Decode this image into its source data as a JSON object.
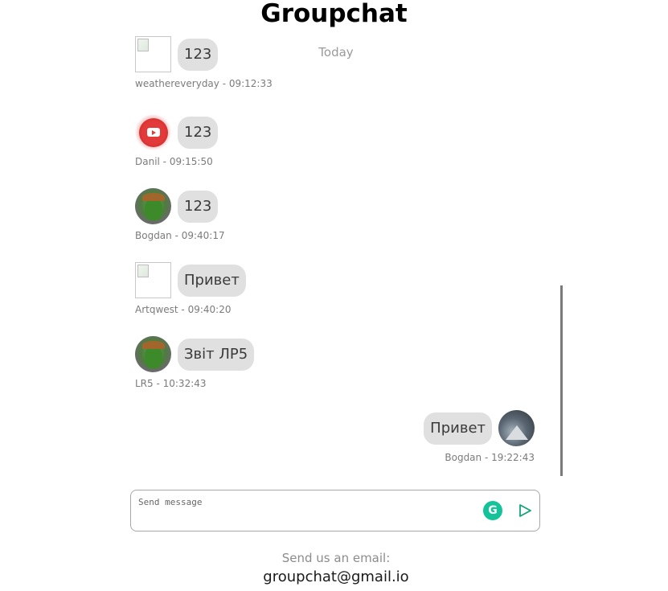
{
  "app": {
    "title": "Groupchat"
  },
  "chat": {
    "day_separator": "Today",
    "messages": [
      {
        "text": "123",
        "author": "weathereveryday",
        "time": "09:12:33",
        "meta": "weathereveryday - 09:12:33",
        "avatar": "broken-image-icon"
      },
      {
        "text": "123",
        "author": "Danil",
        "time": "09:15:50",
        "meta": "Danil - 09:15:50",
        "avatar": "youtube-icon"
      },
      {
        "text": "123",
        "author": "Bogdan",
        "time": "09:40:17",
        "meta": "Bogdan - 09:40:17",
        "avatar": "goblin-avatar"
      },
      {
        "text": "Привет",
        "author": "Artqwest",
        "time": "09:40:20",
        "meta": "Artqwest - 09:40:20",
        "avatar": "broken-image-icon"
      },
      {
        "text": "Звіт ЛР5",
        "author": "LR5",
        "time": "10:32:43",
        "meta": "LR5 - 10:32:43",
        "avatar": "goblin-avatar"
      },
      {
        "text": "Привет",
        "author": "Bogdan",
        "time": "19:22:43",
        "meta": "Bogdan - 19:22:43",
        "avatar": "mountain-avatar",
        "own": true
      }
    ]
  },
  "composer": {
    "placeholder": "Send message",
    "value": "",
    "grammarly_icon": "grammarly-icon",
    "send_icon": "send-icon"
  },
  "footer": {
    "label": "Send us an email:",
    "email": "groupchat@gmail.io"
  },
  "colors": {
    "bubble": "#e0e0e0",
    "meta_text": "#7b7b7b",
    "grammarly": "#15c39a",
    "send": "#15a37a"
  }
}
